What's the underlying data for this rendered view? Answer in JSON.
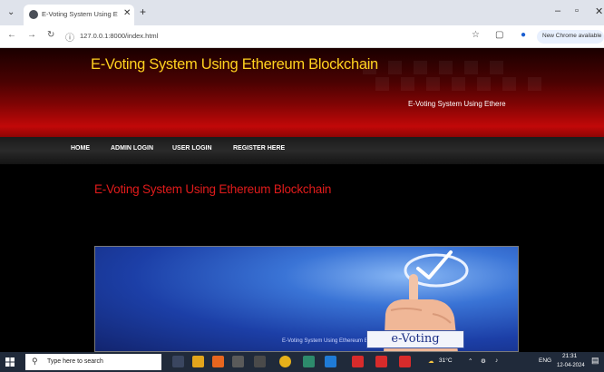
{
  "browser": {
    "tab_title": "E-Voting System Using Ethere",
    "url": "127.0.0.1:8000/index.html",
    "new_chrome_label": "New Chrome available",
    "icons": [
      "menu-icon",
      "close-icon",
      "plus-icon",
      "back-icon",
      "forward-icon",
      "reload-icon",
      "info-icon",
      "star-icon",
      "extensions-icon",
      "profile-icon",
      "kebab-icon"
    ]
  },
  "site": {
    "title": "E-Voting System Using Ethereum Blockchain",
    "subtitle": "E-Voting System Using Ethere",
    "title_color": "#ffd21f",
    "heading_color": "#e01b1b"
  },
  "menu": {
    "items": [
      "HOME",
      "ADMIN LOGIN",
      "USER LOGIN",
      "REGISTER HERE"
    ]
  },
  "main": {
    "heading": "E-Voting System Using Ethereum Blockchain",
    "hero_label": "e-Voting",
    "hero_caption": "E-Voting System Using Ethereum Blockchain"
  },
  "taskbar": {
    "search_placeholder": "Type here to search",
    "temperature": "31°C",
    "language": "ENG",
    "time": "21:31",
    "date": "12-04-2024"
  }
}
